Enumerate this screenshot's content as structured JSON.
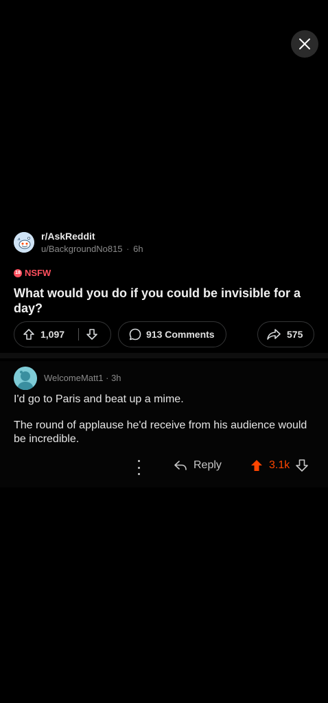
{
  "post": {
    "subreddit": "r/AskReddit",
    "author": "u/BackgroundNo815",
    "age": "6h",
    "nsfw_label": "NSFW",
    "title": "What would you do if you could be invisible for a day?",
    "upvotes": "1,097",
    "comments": "913 Comments",
    "shares": "575"
  },
  "comment": {
    "author": "WelcomeMatt1",
    "age": "3h",
    "paragraphs": [
      "I'd go to Paris and beat up a mime.",
      "The round of applause he'd receive from his audience would be incredible."
    ],
    "reply_label": "Reply",
    "score": "3.1k"
  },
  "colors": {
    "background": "#000000",
    "nsfw": "#ff4f5e",
    "upvote_active": "#ff4500",
    "pill_border": "#343536"
  },
  "icons": [
    "close-icon",
    "subreddit-avatar-icon",
    "upvote-icon",
    "downvote-icon",
    "comment-icon",
    "share-icon",
    "more-icon",
    "reply-icon"
  ]
}
